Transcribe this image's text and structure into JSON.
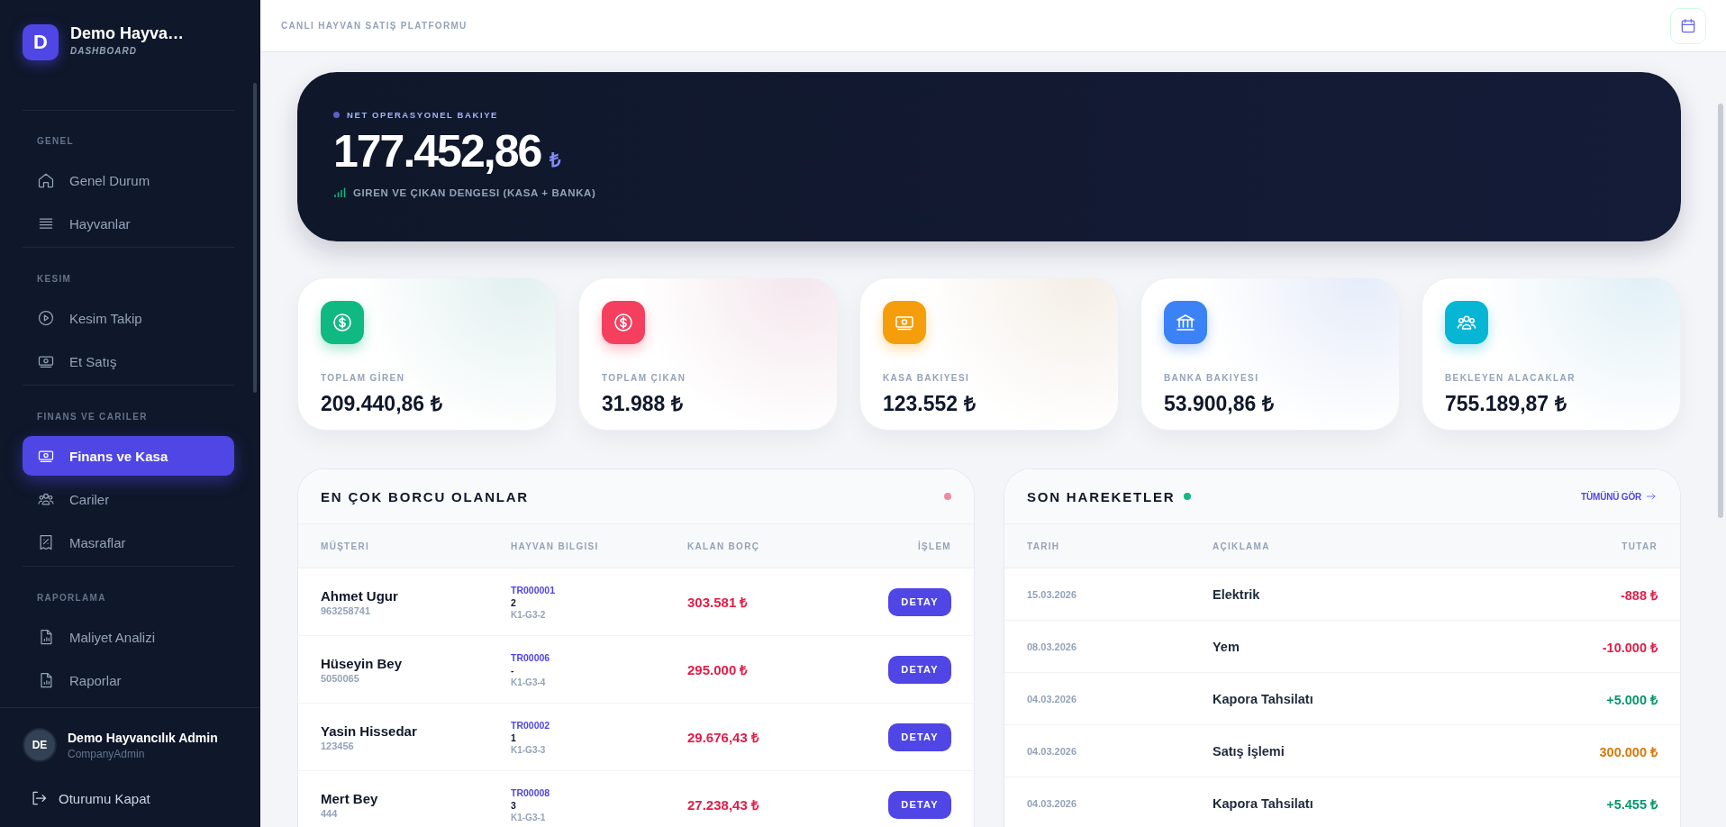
{
  "sidebar": {
    "brand": {
      "initial": "D",
      "name": "Demo Hayva…",
      "subtitle": "DASHBOARD"
    },
    "sections": [
      {
        "label": "GENEL",
        "items": [
          {
            "label": "Genel Durum",
            "kind": "home",
            "selected": false
          },
          {
            "label": "Hayvanlar",
            "kind": "list",
            "selected": false
          }
        ]
      },
      {
        "label": "KESIM",
        "items": [
          {
            "label": "Kesim Takip",
            "kind": "play",
            "selected": false
          },
          {
            "label": "Et Satış",
            "kind": "cash",
            "selected": false
          }
        ]
      },
      {
        "label": "FINANS VE CARILER",
        "items": [
          {
            "label": "Finans ve Kasa",
            "kind": "cash",
            "selected": true
          },
          {
            "label": "Cariler",
            "kind": "users",
            "selected": false
          },
          {
            "label": "Masraflar",
            "kind": "receipt",
            "selected": false
          }
        ]
      },
      {
        "label": "RAPORLAMA",
        "items": [
          {
            "label": "Maliyet Analizi",
            "kind": "report",
            "selected": false
          },
          {
            "label": "Raporlar",
            "kind": "report",
            "selected": false
          }
        ]
      }
    ],
    "user": {
      "initials": "DE",
      "name": "Demo Hayvancılık Admin",
      "role": "CompanyAdmin"
    },
    "logout": "Oturumu Kapat"
  },
  "header": {
    "title": "CANLI HAYVAN SATIŞ PLATFORMU"
  },
  "hero": {
    "label": "NET OPERASYONEL BAKIYE",
    "amount": "177.452,86",
    "currency": "₺",
    "note": "GIREN VE ÇIKAN DENGESI (KASA + BANKA)"
  },
  "stats": [
    {
      "label": "TOPLAM GİREN",
      "value": "209.440,86 ₺",
      "kind": "dollar",
      "color": "#10b981"
    },
    {
      "label": "TOPLAM ÇIKAN",
      "value": "31.988 ₺",
      "kind": "dollar",
      "color": "#f43f5e"
    },
    {
      "label": "KASA BAKIYESI",
      "value": "123.552 ₺",
      "kind": "cash",
      "color": "#f59e0b"
    },
    {
      "label": "BANKA BAKIYESI",
      "value": "53.900,86 ₺",
      "kind": "bank",
      "color": "#3b82f6"
    },
    {
      "label": "BEKLEYEN ALACAKLAR",
      "value": "755.189,87 ₺",
      "kind": "users",
      "color": "#06b6d4"
    }
  ],
  "debtors": {
    "title": "EN ÇOK BORCU OLANLAR",
    "columns": [
      "MÜŞTERI",
      "HAYVAN BILGISI",
      "KALAN BORÇ",
      "İŞLEM"
    ],
    "rows": [
      {
        "name": "Ahmet Ugur",
        "phone": "963258741",
        "tag": "TR000001",
        "count": "2",
        "location": "K1-G3-2",
        "debt": "303.581 ₺",
        "action": "DETAY"
      },
      {
        "name": "Hüseyin Bey",
        "phone": "5050065",
        "tag": "TR00006",
        "count": "-",
        "location": "K1-G3-4",
        "debt": "295.000 ₺",
        "action": "DETAY"
      },
      {
        "name": "Yasin Hissedar",
        "phone": "123456",
        "tag": "TR00002",
        "count": "1",
        "location": "K1-G3-3",
        "debt": "29.676,43 ₺",
        "action": "DETAY"
      },
      {
        "name": "Mert Bey",
        "phone": "444",
        "tag": "TR00008",
        "count": "3",
        "location": "K1-G3-1",
        "debt": "27.238,43 ₺",
        "action": "DETAY"
      }
    ]
  },
  "transactions": {
    "title": "SON HAREKETLER",
    "link": "TÜMÜNÜ GÖR",
    "columns": [
      "TARIH",
      "AÇIKLAMA",
      "TUTAR"
    ],
    "rows": [
      {
        "date": "15.03.2026",
        "description": "Elektrik",
        "amount": "-888 ₺",
        "color": "#e11d48"
      },
      {
        "date": "08.03.2026",
        "description": "Yem",
        "amount": "-10.000 ₺",
        "color": "#e11d48"
      },
      {
        "date": "04.03.2026",
        "description": "Kapora Tahsilatı",
        "amount": "+5.000 ₺",
        "color": "#059669"
      },
      {
        "date": "04.03.2026",
        "description": "Satış İşlemi",
        "amount": "300.000 ₺",
        "color": "#d97706"
      },
      {
        "date": "04.03.2026",
        "description": "Kapora Tahsilatı",
        "amount": "+5.455 ₺",
        "color": "#059669"
      }
    ]
  }
}
